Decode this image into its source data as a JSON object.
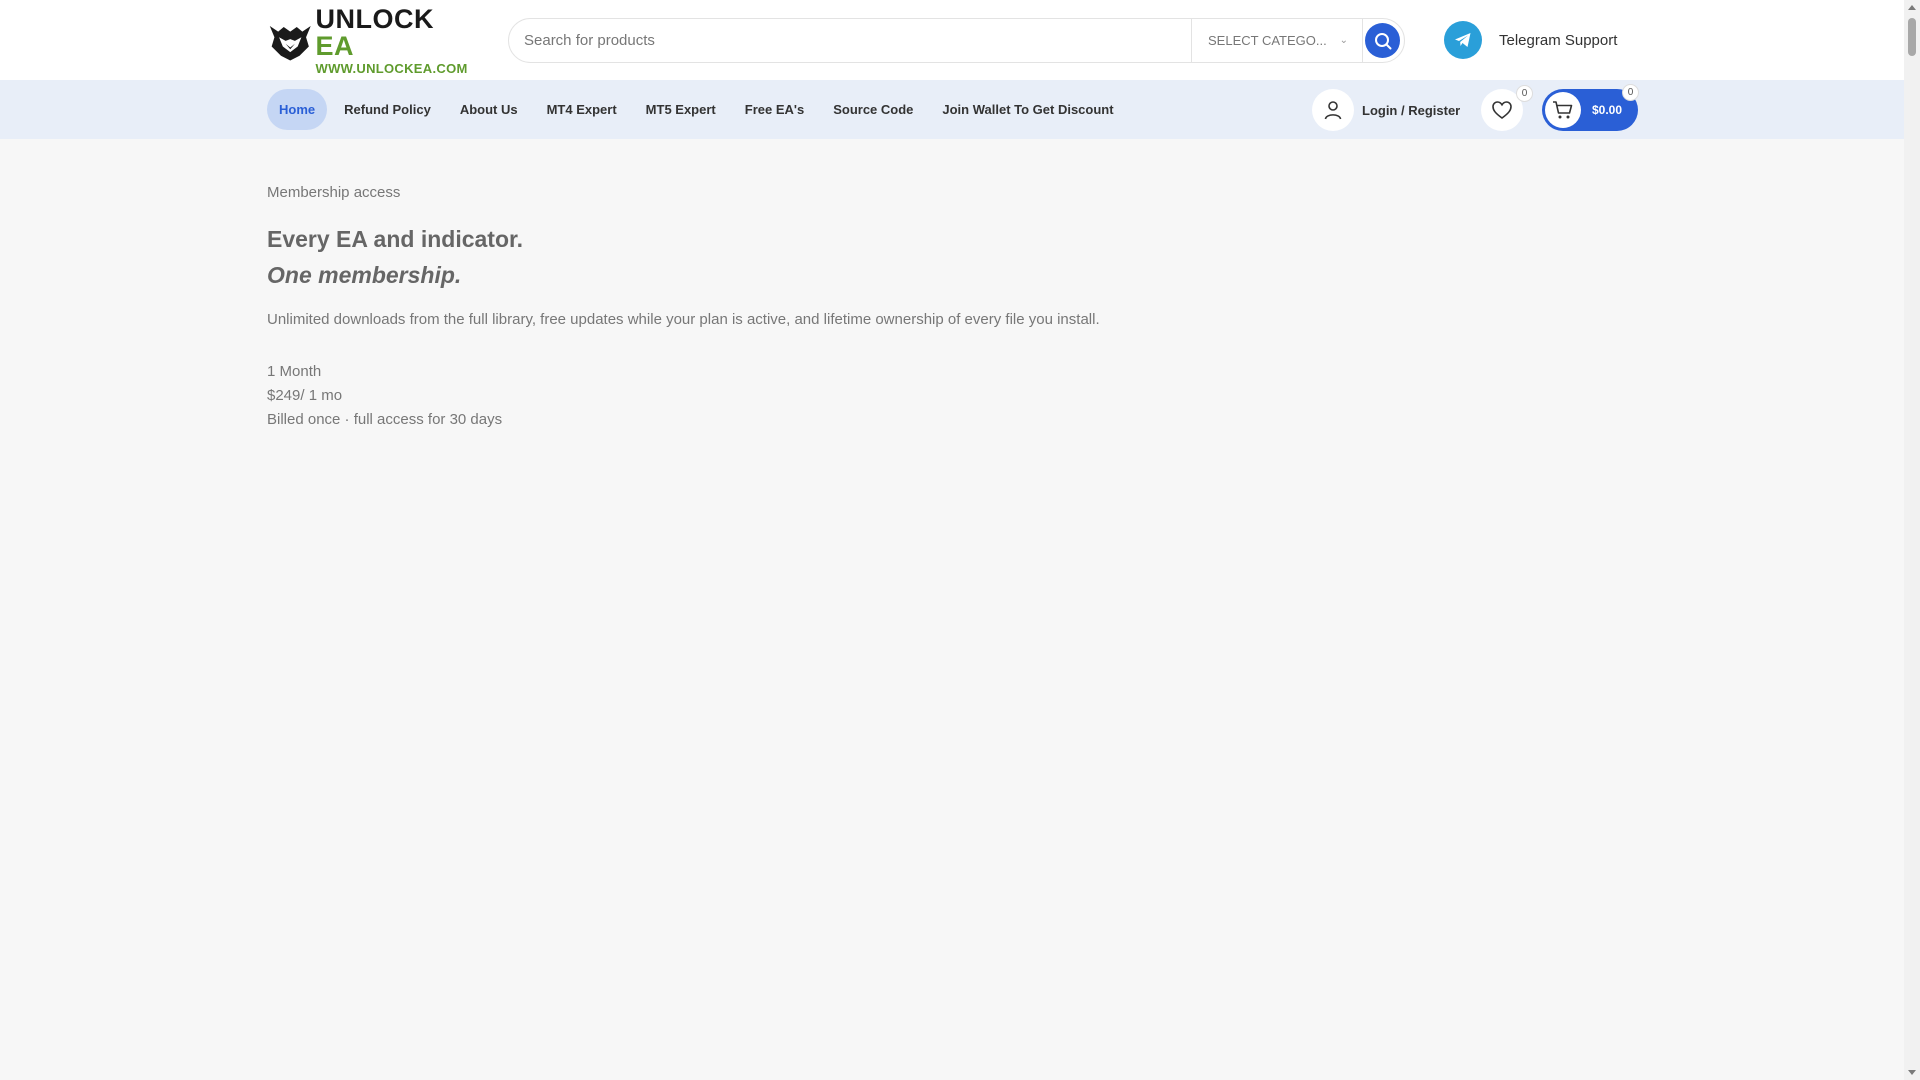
{
  "header": {
    "logo": {
      "title_main": "UNLOCK",
      "title_accent": "EA",
      "url": "WWW.UNLOCKEA.COM"
    },
    "search": {
      "placeholder": "Search for products",
      "value": "",
      "category": "SELECT CATEGO..."
    },
    "telegram": {
      "label": "Telegram Support"
    }
  },
  "nav": {
    "items": [
      {
        "label": "Home",
        "active": true
      },
      {
        "label": "Refund Policy"
      },
      {
        "label": "About Us"
      },
      {
        "label": "MT4 Expert"
      },
      {
        "label": "MT5 Expert"
      },
      {
        "label": "Free EA's"
      },
      {
        "label": "Source Code"
      },
      {
        "label": "Join Wallet To Get Discount"
      }
    ],
    "account_label": "Login / Register",
    "wishlist_count": "0",
    "cart": {
      "total": "$0.00",
      "count": "0"
    }
  },
  "main": {
    "eyebrow": "Membership access",
    "headline_line1": "Every EA and indicator.",
    "headline_line2": "One membership.",
    "description": "Unlimited downloads from the full library, free updates while your plan is active, and lifetime ownership of every file you install.",
    "plan": {
      "name": "1 Month",
      "price": "$249/ 1 mo",
      "billing": "Billed once · full access for 30 days"
    }
  },
  "colors": {
    "accent": "#2a5fd6",
    "brand_green": "#5f9b2d",
    "nav_bg": "#e8eef8",
    "telegram": "#2a9fd9"
  }
}
